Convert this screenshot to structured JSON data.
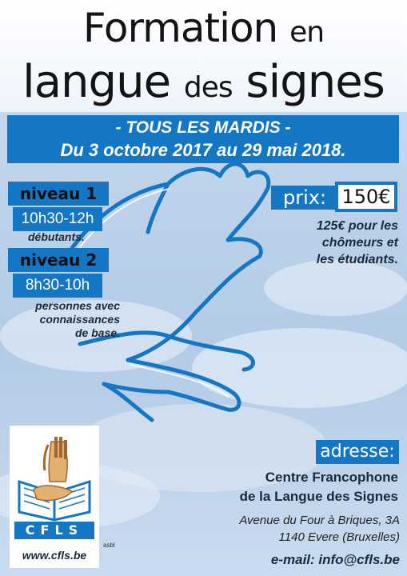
{
  "title": {
    "line1_main": "Formation",
    "line1_small": "en",
    "line2_main1": "langue",
    "line2_small": "des",
    "line2_main2": "signes"
  },
  "schedule": {
    "line1": "- TOUS LES MARDIS -",
    "line2": "Du 3 octobre 2017 au 29 mai 2018."
  },
  "levels": [
    {
      "label": "niveau 1",
      "hours": "10h30-12h",
      "audience": "débutants."
    },
    {
      "label": "niveau 2",
      "hours": "8h30-10h",
      "audience_lines": [
        "personnes avec",
        "connaissances",
        "de base."
      ]
    }
  ],
  "price": {
    "label": "prix:",
    "value": "150€",
    "reduction_lines": [
      "125€ pour les",
      "chômeurs et",
      "les étudiants."
    ]
  },
  "logo": {
    "letters": "CFLS",
    "asbl": "asbl",
    "website": "www.cfls.be"
  },
  "address": {
    "label": "adresse:",
    "org_lines": [
      "Centre Francophone",
      "de la Langue des Signes"
    ],
    "street_lines": [
      "Avenue du Four à Briques, 3A",
      "1140 Evere (Bruxelles)"
    ],
    "email": "e-mail: info@cfls.be"
  },
  "colors": {
    "accent": "#1577c4",
    "text_dark": "#1a2a3a"
  }
}
